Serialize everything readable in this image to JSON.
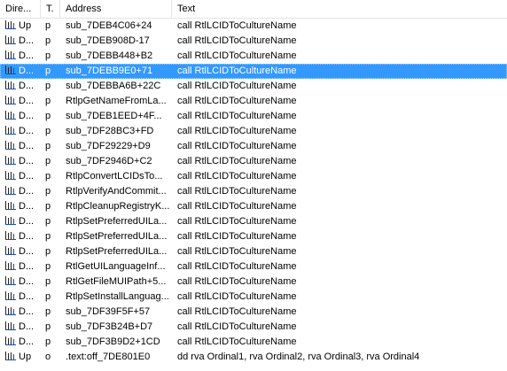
{
  "columns": {
    "direction": "Dire...",
    "type": "T.",
    "address": "Address",
    "text": "Text"
  },
  "rows": [
    {
      "direction": "Up",
      "type": "p",
      "address": "sub_7DEB4C06+24",
      "text": "call   RtlLCIDToCultureName"
    },
    {
      "direction": "D...",
      "type": "p",
      "address": "sub_7DEB908D-17",
      "text": "call   RtlLCIDToCultureName"
    },
    {
      "direction": "D...",
      "type": "p",
      "address": "sub_7DEBB448+B2",
      "text": "call   RtlLCIDToCultureName"
    },
    {
      "direction": "D...",
      "type": "p",
      "address": "sub_7DEBB9E0+71",
      "text": "call   RtlLCIDToCultureName"
    },
    {
      "direction": "D...",
      "type": "p",
      "address": "sub_7DEBBA6B+22C",
      "text": "call   RtlLCIDToCultureName"
    },
    {
      "direction": "D...",
      "type": "p",
      "address": "RtlpGetNameFromLa...",
      "text": "call   RtlLCIDToCultureName"
    },
    {
      "direction": "D...",
      "type": "p",
      "address": "sub_7DEB1EED+4F...",
      "text": "call   RtlLCIDToCultureName"
    },
    {
      "direction": "D...",
      "type": "p",
      "address": "sub_7DF28BC3+FD",
      "text": "call   RtlLCIDToCultureName"
    },
    {
      "direction": "D...",
      "type": "p",
      "address": "sub_7DF29229+D9",
      "text": "call   RtlLCIDToCultureName"
    },
    {
      "direction": "D...",
      "type": "p",
      "address": "sub_7DF2946D+C2",
      "text": "call   RtlLCIDToCultureName"
    },
    {
      "direction": "D...",
      "type": "p",
      "address": "RtlpConvertLCIDsTo...",
      "text": "call   RtlLCIDToCultureName"
    },
    {
      "direction": "D...",
      "type": "p",
      "address": "RtlpVerifyAndCommit...",
      "text": "call   RtlLCIDToCultureName"
    },
    {
      "direction": "D...",
      "type": "p",
      "address": "RtlpCleanupRegistryK...",
      "text": "call   RtlLCIDToCultureName"
    },
    {
      "direction": "D...",
      "type": "p",
      "address": "RtlpSetPreferredUILa...",
      "text": "call   RtlLCIDToCultureName"
    },
    {
      "direction": "D...",
      "type": "p",
      "address": "RtlpSetPreferredUILa...",
      "text": "call   RtlLCIDToCultureName"
    },
    {
      "direction": "D...",
      "type": "p",
      "address": "RtlpSetPreferredUILa...",
      "text": "call   RtlLCIDToCultureName"
    },
    {
      "direction": "D...",
      "type": "p",
      "address": "RtlGetUILanguageInf...",
      "text": "call   RtlLCIDToCultureName"
    },
    {
      "direction": "D...",
      "type": "p",
      "address": "RtlGetFileMUIPath+5...",
      "text": "call   RtlLCIDToCultureName"
    },
    {
      "direction": "D...",
      "type": "p",
      "address": "RtlpSetInstallLanguag...",
      "text": "call   RtlLCIDToCultureName"
    },
    {
      "direction": "D...",
      "type": "p",
      "address": "sub_7DF39F5F+57",
      "text": "call   RtlLCIDToCultureName"
    },
    {
      "direction": "D...",
      "type": "p",
      "address": "sub_7DF3B24B+D7",
      "text": "call   RtlLCIDToCultureName"
    },
    {
      "direction": "D...",
      "type": "p",
      "address": "sub_7DF3B9D2+1CD",
      "text": "call   RtlLCIDToCultureName"
    },
    {
      "direction": "Up",
      "type": "o",
      "address": ".text:off_7DE801E0",
      "text": "dd rva Ordinal1, rva Ordinal2, rva Ordinal3, rva Ordinal4"
    }
  ],
  "selected_row": 3,
  "icons": {
    "row_icon": "xref-direction-icon"
  },
  "colors": {
    "selection": "#3399ff",
    "selection_text": "#ffffff",
    "grid_line": "#e3e3e3"
  }
}
